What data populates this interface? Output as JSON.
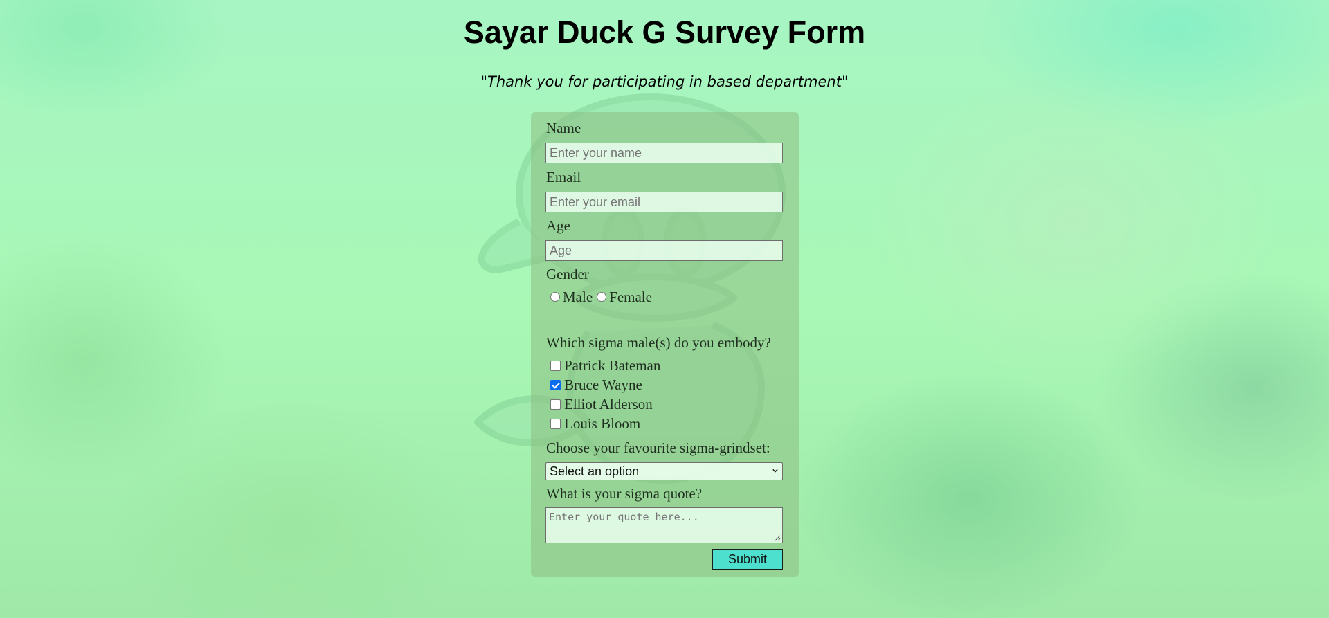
{
  "page": {
    "title": "Sayar Duck G Survey Form",
    "subtitle": "\"Thank you for participating in based department\""
  },
  "form": {
    "name": {
      "label": "Name",
      "placeholder": "Enter your name"
    },
    "email": {
      "label": "Email",
      "placeholder": "Enter your email"
    },
    "age": {
      "label": "Age",
      "placeholder": "Age"
    },
    "gender": {
      "label": "Gender",
      "options": [
        "Male",
        "Female"
      ]
    },
    "sigma": {
      "label": "Which sigma male(s) do you embody?",
      "options": [
        {
          "label": "Patrick Bateman",
          "checked": false
        },
        {
          "label": "Bruce Wayne",
          "checked": true
        },
        {
          "label": "Elliot Alderson",
          "checked": false
        },
        {
          "label": "Louis Bloom",
          "checked": false
        }
      ]
    },
    "grindset": {
      "label": "Choose your favourite sigma-grindset:",
      "selected": "Select an option"
    },
    "quote": {
      "label": "What is your sigma quote?",
      "placeholder": "Enter your quote here..."
    },
    "submit_label": "Submit"
  },
  "colors": {
    "accent": "#4ee0cf",
    "checkbox_checked": "#0b6cf0",
    "background": "#a9f8b6"
  },
  "icons": {
    "select_arrow": "chevron-down-icon",
    "textarea_resize": "resize-grip-icon",
    "background_art": "duck-illustration"
  }
}
